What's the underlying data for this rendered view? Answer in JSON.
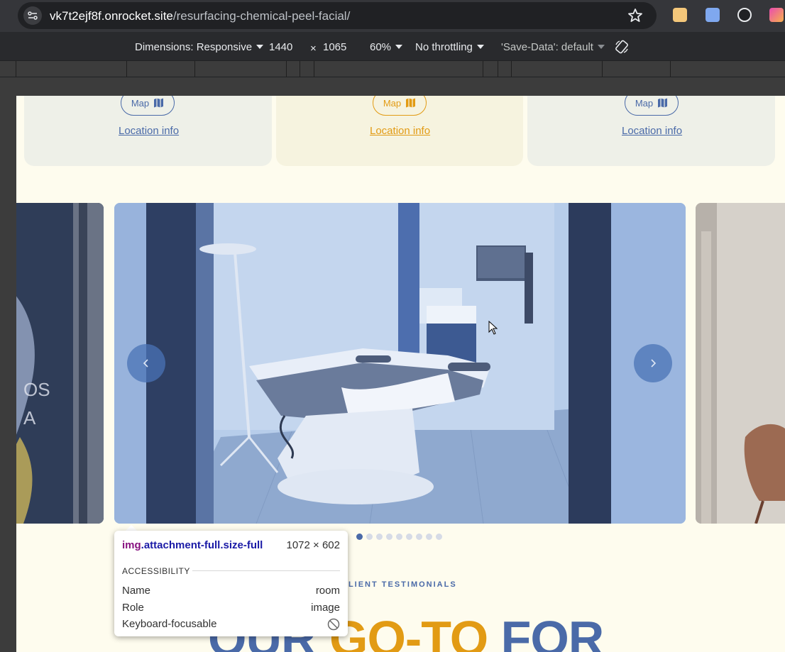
{
  "browser": {
    "url_host": "vk7t2ejf8f.onrocket.site",
    "url_path": "/resurfacing-chemical-peel-facial/"
  },
  "device_toolbar": {
    "dimensions_label": "Dimensions: Responsive",
    "width": "1440",
    "times": "×",
    "height": "1065",
    "zoom": "60%",
    "throttling": "No throttling",
    "save_data": "'Save-Data': default"
  },
  "locations": [
    {
      "map_label": "Map",
      "link_label": "Location info",
      "color": "#4a6aa8",
      "bg": "#eef0e8"
    },
    {
      "map_label": "Map",
      "link_label": "Location info",
      "color": "#e29b14",
      "bg": "#f6f3df"
    },
    {
      "map_label": "Map",
      "link_label": "Location info",
      "color": "#4a6aa8",
      "bg": "#eef0e8"
    }
  ],
  "carousel": {
    "dot_count": 9,
    "active_dot": 0
  },
  "testimonials": {
    "label": "CLIENT TESTIMONIALS",
    "headline_part1": "OUR ",
    "headline_part2": "GO-TO",
    "headline_part3": " FOR"
  },
  "tooltip": {
    "tag": "img",
    "classes": ".attachment-full.size-full",
    "size": "1072 × 602",
    "section": "ACCESSIBILITY",
    "name_label": "Name",
    "name_value": "room",
    "role_label": "Role",
    "role_value": "image",
    "focus_label": "Keyboard-focusable"
  }
}
